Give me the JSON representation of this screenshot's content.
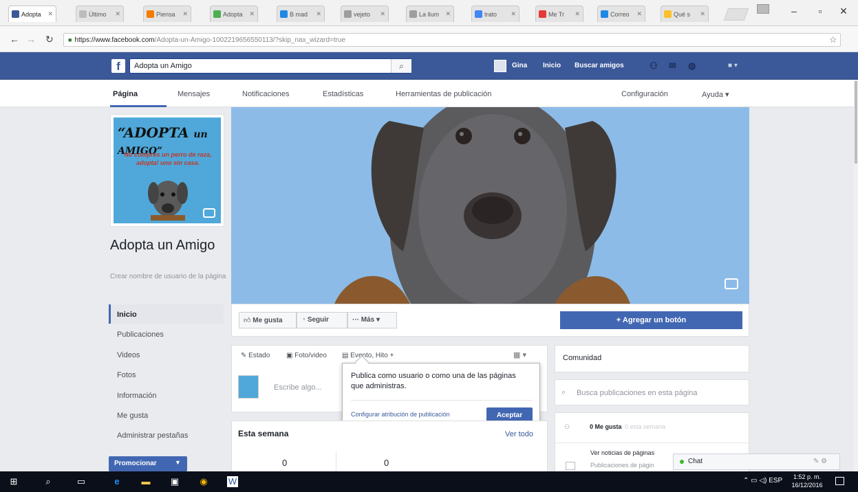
{
  "browser": {
    "tabs": [
      {
        "label": "Adopta",
        "color": "#3b5998"
      },
      {
        "label": "Último",
        "color": "#bdbdbd"
      },
      {
        "label": "Piensa",
        "color": "#f57c00"
      },
      {
        "label": "Adopta",
        "color": "#4caf50"
      },
      {
        "label": "B mad",
        "color": "#1e88e5"
      },
      {
        "label": "vejeto",
        "color": "#9e9e9e"
      },
      {
        "label": "La llum",
        "color": "#9e9e9e"
      },
      {
        "label": "trato",
        "color": "#4285f4"
      },
      {
        "label": "Me Tr",
        "color": "#e53935"
      },
      {
        "label": "Correo",
        "color": "#1e88e5"
      },
      {
        "label": "Qué s",
        "color": "#fbc02d"
      }
    ],
    "url_host": "https://www.facebook.com",
    "url_path": "/Adopta-un-Amigo-1002219656550113/?skip_nax_wizard=true"
  },
  "fb_header": {
    "logo": "f",
    "search_value": "Adopta un Amigo",
    "user_name": "Gina",
    "nav_home": "Inicio",
    "nav_find_friends": "Buscar amigos"
  },
  "page_tabs": {
    "pagina": "Página",
    "mensajes": "Mensajes",
    "notificaciones": "Notificaciones",
    "estadisticas": "Estadísticas",
    "herramientas": "Herramientas de publicación",
    "configuracion": "Configuración",
    "ayuda": "Ayuda ▾"
  },
  "profile": {
    "pic_title_1": "“ADOPTA",
    "pic_title_2": "un AMIGO”",
    "pic_tagline": "No compres un perro de raza, adopta! uno sin casa.",
    "page_name": "Adopta un Amigo",
    "username_cta": "Crear nombre de usuario de la página"
  },
  "left_nav": {
    "inicio": "Inicio",
    "publicaciones": "Publicaciones",
    "videos": "Videos",
    "fotos": "Fotos",
    "informacion": "Información",
    "me_gusta": "Me gusta",
    "administrar": "Administrar pestañas",
    "promocionar": "Promocionar"
  },
  "actions": {
    "like": "Me gusta",
    "follow": "Seguir",
    "more": "··· Más ▾",
    "add_button": "+ Agregar un botón"
  },
  "composer": {
    "estado": "Estado",
    "foto_video": "Foto/video",
    "evento": "Evento, Hito +",
    "placeholder": "Escribe algo..."
  },
  "popup": {
    "text": "Publica como usuario o como una de las páginas que administras.",
    "link": "Configurar atribución de publicación",
    "ok": "Aceptar"
  },
  "week": {
    "title": "Esta semana",
    "link": "Ver todo",
    "val_1": "0",
    "val_2": "0"
  },
  "right": {
    "comunidad": "Comunidad",
    "search_placeholder": "Busca publicaciones en esta página",
    "likes_count": "0 Me gusta",
    "likes_sub": "0 esta semana",
    "notif_title": "Ver noticias de páginas",
    "notif_sub": "Publicaciones de págin"
  },
  "chat": {
    "label": "Chat"
  },
  "taskbar": {
    "lang": "ESP",
    "time": "1:52 p. m.",
    "date": "16/12/2016"
  },
  "colors": {
    "fb_blue": "#3b5998",
    "button_blue": "#4267b2",
    "cover_bg": "#8cbbe8"
  }
}
